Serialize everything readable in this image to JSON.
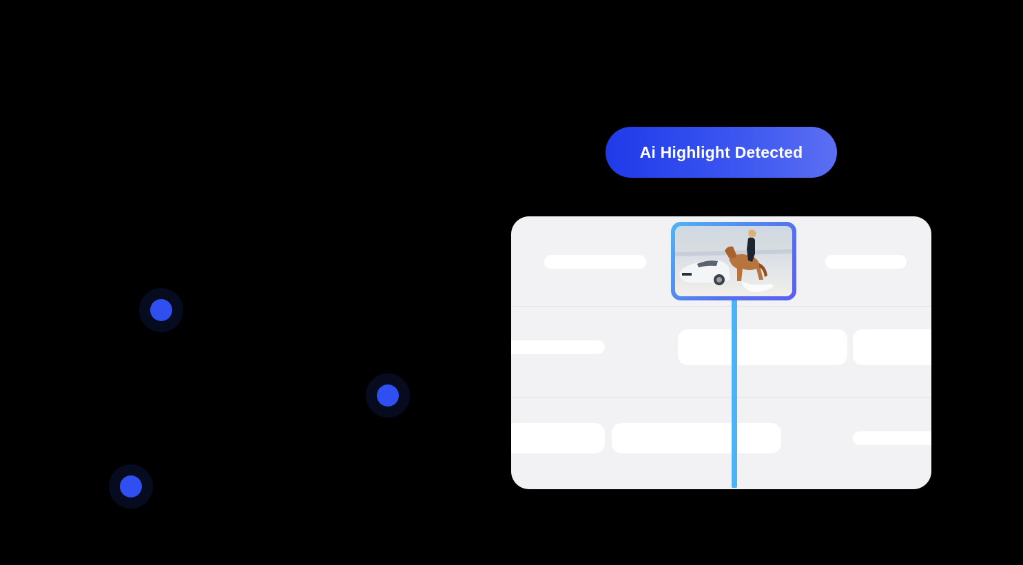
{
  "badge": {
    "label": "Ai Highlight Detected",
    "gradient_start": "#1f3ae8",
    "gradient_end": "#5c6ff2"
  },
  "colors": {
    "background": "#000000",
    "dot": "#2f4ff0",
    "panel": "#f2f2f4",
    "playhead": "#4cb3f4"
  },
  "thumbnail": {
    "icon": "video-frame-thumbnail"
  }
}
